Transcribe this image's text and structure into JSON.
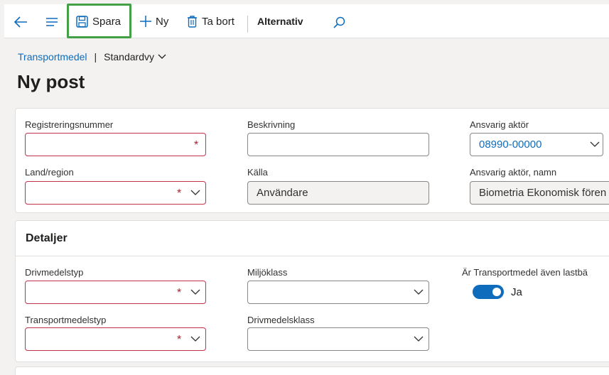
{
  "toolbar": {
    "save_label": "Spara",
    "new_label": "Ny",
    "delete_label": "Ta bort",
    "options_label": "Alternativ"
  },
  "breadcrumb": {
    "entity": "Transportmedel",
    "separator": "|",
    "view": "Standardvy"
  },
  "page_title": "Ny post",
  "general": {
    "reg_label": "Registreringsnummer",
    "reg_value": "",
    "desc_label": "Beskrivning",
    "desc_value": "",
    "actor_label": "Ansvarig aktör",
    "actor_value": "08990-00000",
    "country_label": "Land/region",
    "country_value": "",
    "source_label": "Källa",
    "source_value": "Användare",
    "actor_name_label": "Ansvarig aktör, namn",
    "actor_name_value": "Biometria Ekonomisk fören"
  },
  "details": {
    "title": "Detaljer",
    "fuel_type_label": "Drivmedelstyp",
    "env_class_label": "Miljöklass",
    "is_truck_label": "Är Transportmedel även lastbä",
    "is_truck_value": "Ja",
    "is_truck_on": true,
    "transport_type_label": "Transportmedelstyp",
    "fuel_class_label": "Drivmedelsklass"
  },
  "required_mark": "*",
  "colors": {
    "accent": "#0f6cbd",
    "required": "#c4314b",
    "highlight": "#43a047"
  }
}
